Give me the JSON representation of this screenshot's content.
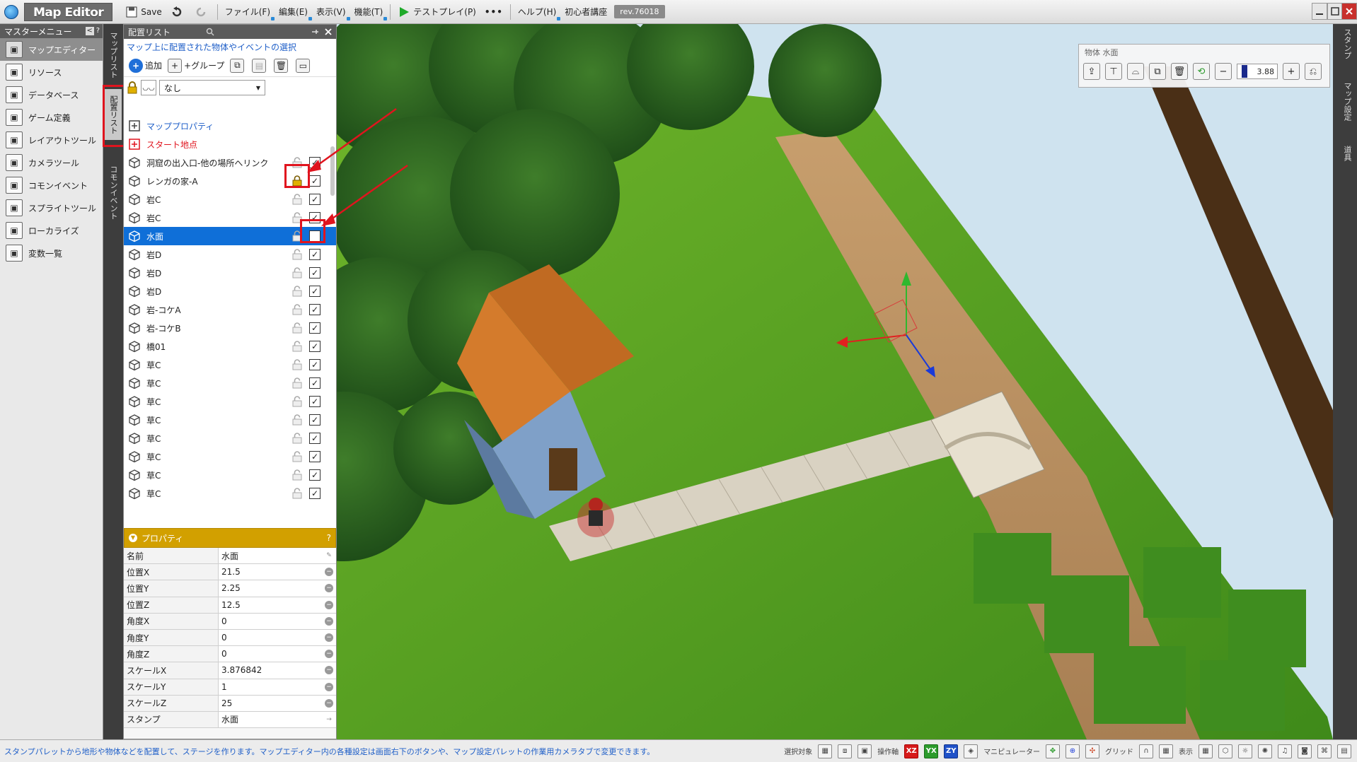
{
  "titlebar": {
    "app_title": "Map Editor",
    "save_label": "Save",
    "menus": [
      "ファイル(F)",
      "編集(E)",
      "表示(V)",
      "機能(T)"
    ],
    "testplay_label": "テストプレイ(P)",
    "more_label": "•••",
    "help_label": "ヘルプ(H)",
    "tutorial_label": "初心者講座",
    "revision": "rev.76018"
  },
  "master_menu": {
    "title": "マスターメニュー",
    "items": [
      {
        "label": "マップエディター",
        "icon": "map-editor-icon",
        "active": true
      },
      {
        "label": "リソース",
        "icon": "resource-icon",
        "active": false
      },
      {
        "label": "データベース",
        "icon": "database-icon",
        "active": false
      },
      {
        "label": "ゲーム定義",
        "icon": "game-definition-icon",
        "active": false
      },
      {
        "label": "レイアウトツール",
        "icon": "layout-tool-icon",
        "active": false
      },
      {
        "label": "カメラツール",
        "icon": "camera-tool-icon",
        "active": false
      },
      {
        "label": "コモンイベント",
        "icon": "common-event-icon",
        "active": false
      },
      {
        "label": "スプライトツール",
        "icon": "sprite-tool-icon",
        "active": false
      },
      {
        "label": "ローカライズ",
        "icon": "localize-icon",
        "active": false
      },
      {
        "label": "変数一覧",
        "icon": "variable-list-icon",
        "active": false
      }
    ]
  },
  "vertical_tabs": {
    "map_list": "マップリスト",
    "placement_list": "配置リスト",
    "common_event": "コモンイベント"
  },
  "placement_panel": {
    "title": "配置リスト",
    "description": "マップ上に配置された物体やイベントの選択",
    "add_label": "追加",
    "group_label": "+グループ",
    "filter_value": "なし",
    "rows": [
      {
        "label": "マッププロパティ",
        "kind": "link",
        "lock": false,
        "check": null
      },
      {
        "label": "スタート地点",
        "kind": "start",
        "lock": false,
        "check": null
      },
      {
        "label": "洞窟の出入口-他の場所へリンク",
        "kind": "normal",
        "lock": false,
        "check": true
      },
      {
        "label": "レンガの家-A",
        "kind": "normal",
        "lock": true,
        "check": true
      },
      {
        "label": "岩C",
        "kind": "normal",
        "lock": false,
        "check": true
      },
      {
        "label": "岩C",
        "kind": "normal",
        "lock": false,
        "check": true
      },
      {
        "label": "水面",
        "kind": "selected",
        "lock": false,
        "check": false
      },
      {
        "label": "岩D",
        "kind": "normal",
        "lock": false,
        "check": true
      },
      {
        "label": "岩D",
        "kind": "normal",
        "lock": false,
        "check": true
      },
      {
        "label": "岩D",
        "kind": "normal",
        "lock": false,
        "check": true
      },
      {
        "label": "岩-コケA",
        "kind": "normal",
        "lock": false,
        "check": true
      },
      {
        "label": "岩-コケB",
        "kind": "normal",
        "lock": false,
        "check": true
      },
      {
        "label": "橋01",
        "kind": "normal",
        "lock": false,
        "check": true
      },
      {
        "label": "草C",
        "kind": "normal",
        "lock": false,
        "check": true
      },
      {
        "label": "草C",
        "kind": "normal",
        "lock": false,
        "check": true
      },
      {
        "label": "草C",
        "kind": "normal",
        "lock": false,
        "check": true
      },
      {
        "label": "草C",
        "kind": "normal",
        "lock": false,
        "check": true
      },
      {
        "label": "草C",
        "kind": "normal",
        "lock": false,
        "check": true
      },
      {
        "label": "草C",
        "kind": "normal",
        "lock": false,
        "check": true
      },
      {
        "label": "草C",
        "kind": "normal",
        "lock": false,
        "check": true
      },
      {
        "label": "草C",
        "kind": "normal",
        "lock": false,
        "check": true
      }
    ]
  },
  "properties": {
    "title": "プロパティ",
    "help": "?",
    "rows": [
      {
        "key": "名前",
        "value": "水面"
      },
      {
        "key": "位置X",
        "value": "21.5"
      },
      {
        "key": "位置Y",
        "value": "2.25"
      },
      {
        "key": "位置Z",
        "value": "12.5"
      },
      {
        "key": "角度X",
        "value": "0"
      },
      {
        "key": "角度Y",
        "value": "0"
      },
      {
        "key": "角度Z",
        "value": "0"
      },
      {
        "key": "スケールX",
        "value": "3.876842"
      },
      {
        "key": "スケールY",
        "value": "1"
      },
      {
        "key": "スケールZ",
        "value": "25"
      },
      {
        "key": "スタンプ",
        "value": "水面"
      }
    ]
  },
  "object_toolbar": {
    "title": "物体 水面",
    "zoom": "3.88"
  },
  "right_tabs": {
    "stamp": "スタンプ",
    "map_settings": "マップ設定",
    "tool": "道具"
  },
  "statusbar": {
    "hint": "スタンプパレットから地形や物体などを配置して、ステージを作ります。マップエディター内の各種設定は画面右下のボタンや、マップ設定パレットの作業用カメラタブで変更できます。",
    "select_target": "選択対象",
    "operation_axis": "操作軸",
    "manipulator": "マニピュレーター",
    "grid": "グリッド",
    "display": "表示",
    "axis_xz": "XZ",
    "axis_yx": "YX",
    "axis_zy": "ZY"
  },
  "colors": {
    "selection": "#0f6fd8",
    "properties_header": "#d2a000",
    "annotation_red": "#e0141e",
    "link_blue": "#1f5fc8"
  }
}
